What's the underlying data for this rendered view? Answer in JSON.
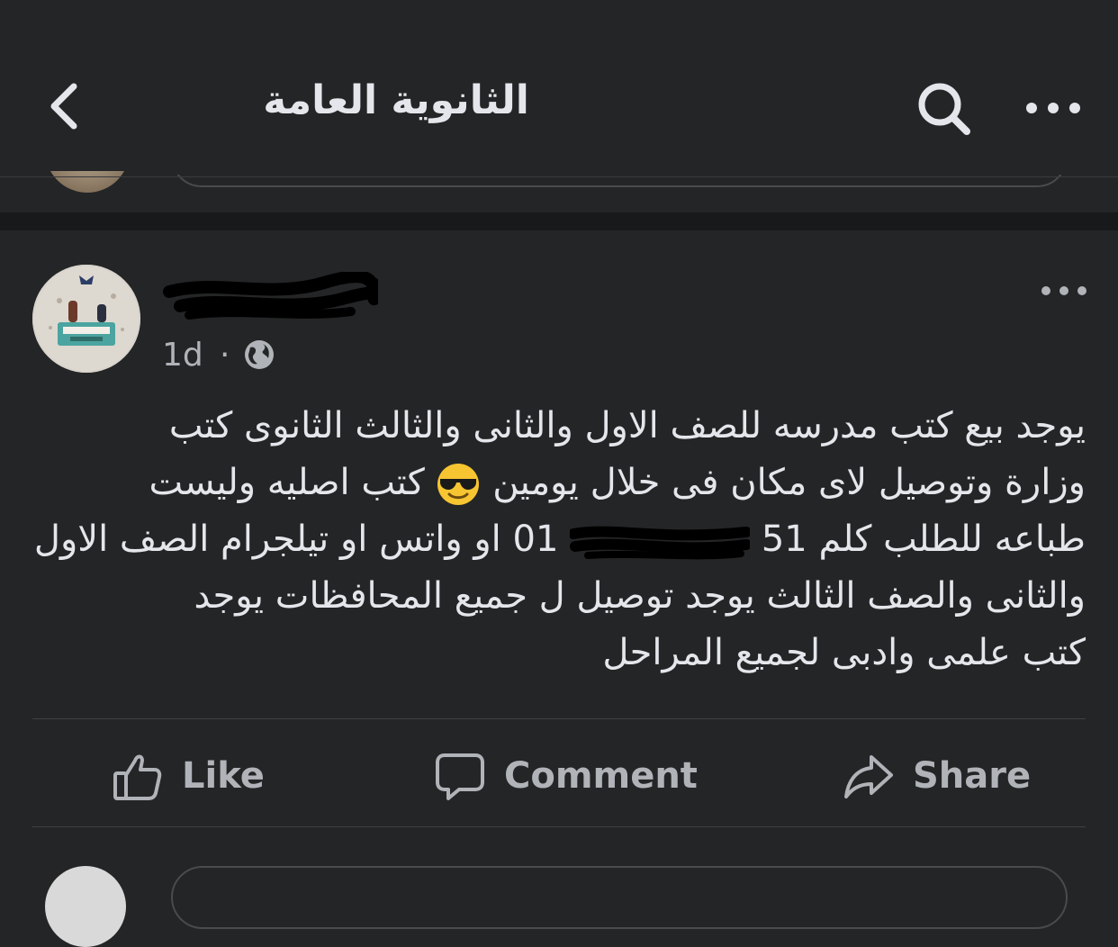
{
  "header": {
    "title": "الثانوية العامة",
    "back_icon": "chevron-left-icon",
    "search_icon": "search-icon",
    "more_icon": "more-horizontal-icon"
  },
  "post": {
    "time": "1d",
    "separator": "·",
    "privacy_icon": "globe-icon",
    "more_icon": "more-horizontal-icon",
    "text_lines": [
      "يوجد بيع كتب مدرسه للصف الاول والثانى والثالث الثانوى كتب",
      "وزارة وتوصيل لاى مكان فى خلال يومين",
      "كتب اصليه وليست",
      "طباعه للطلب كلم",
      "او واتس او تيلجرام الصف الاول",
      "والثانى  والصف الثالث  يوجد توصيل ل جميع المحافظات يوجد",
      "كتب علمى وادبى لجميع المراحل"
    ],
    "phone_prefix": "01",
    "phone_suffix": "51",
    "emoji": "smiling-face-with-sunglasses",
    "actions": {
      "like": "Like",
      "comment": "Comment",
      "share": "Share"
    }
  },
  "colors": {
    "background": "#242526",
    "band": "#18191a",
    "text_primary": "#e4e6eb",
    "text_secondary": "#b0b3b8",
    "divider": "#3e4042"
  }
}
